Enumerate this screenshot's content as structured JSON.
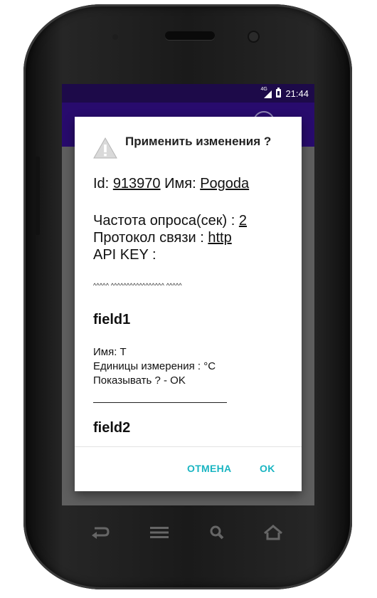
{
  "status_bar": {
    "network_label": "4G",
    "time": "21:44"
  },
  "dialog": {
    "title": "Применить изменения ?",
    "id_label": "Id:",
    "id_value": "913970",
    "name_label": "Имя:",
    "name_value": "Pogoda",
    "poll_label": "Частота опроса(сек) :",
    "poll_value": "2",
    "protocol_label": "Протокол связи :",
    "protocol_value": "http",
    "api_key_label": "API KEY :",
    "api_key_value": "^^^^^ ^^^^^^^^^^^^^^^^^ ^^^^^",
    "fields": [
      {
        "title": "field1",
        "name_line": "Имя: T",
        "units_line": "Единицы измерения : °C",
        "show_line": "Показывать ? - OK"
      },
      {
        "title": "field2"
      }
    ],
    "cancel_label": "ОТМЕНА",
    "ok_label": "OK"
  },
  "nav_bar": {
    "icons": [
      "back-icon",
      "menu-icon",
      "search-icon",
      "home-icon"
    ]
  },
  "colors": {
    "status_bar": "#1d0a49",
    "app_bar": "#280b6d",
    "accent": "#1ab5c2",
    "scrim": "#5f5f5f"
  }
}
